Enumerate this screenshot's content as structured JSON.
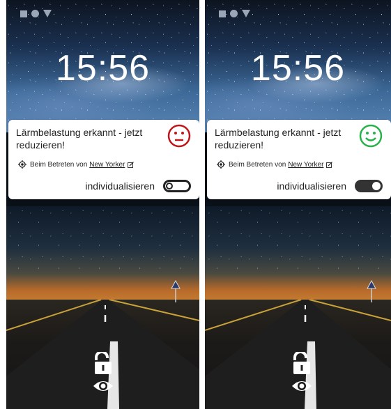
{
  "screens": [
    {
      "time": "15:56",
      "message": "Lärmbelastung erkannt - jetzt reduzieren!",
      "smiley": "neutral-face-icon",
      "smiley_color": "#c0161b",
      "location_prefix": "Beim Betreten von",
      "location_name": "New Yorker",
      "customize_label": "individualisieren",
      "toggle_state": "off"
    },
    {
      "time": "15:56",
      "message": "Lärmbelastung erkannt - jetzt reduzieren!",
      "smiley": "happy-face-icon",
      "smiley_color": "#27b24a",
      "location_prefix": "Beim Betreten von",
      "location_name": "New Yorker",
      "customize_label": "individualisieren",
      "toggle_state": "on"
    }
  ],
  "icons": {
    "status": [
      "square-icon",
      "circle-icon",
      "triangle-icon"
    ],
    "location": "location-target-icon",
    "edit": "edit-icon",
    "unlock": "unlock-icon",
    "eye": "eye-icon"
  }
}
